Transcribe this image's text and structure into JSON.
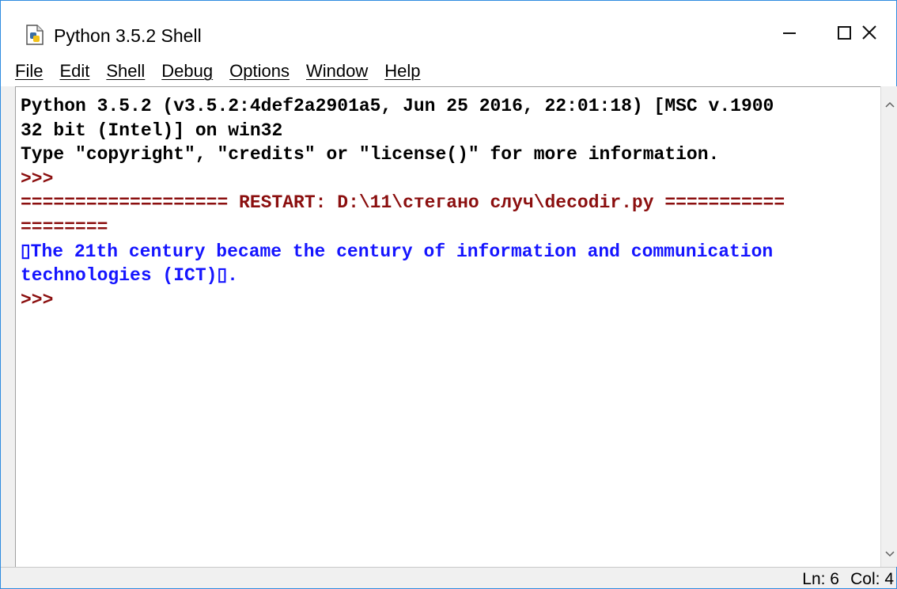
{
  "window": {
    "title": "Python 3.5.2 Shell",
    "icon": "python-file-icon"
  },
  "menubar": {
    "items": [
      "File",
      "Edit",
      "Shell",
      "Debug",
      "Options",
      "Window",
      "Help"
    ]
  },
  "shell": {
    "lines": [
      "Python 3.5.2 (v3.5.2:4def2a2901a5, Jun 25 2016, 22:01:18) [MSC v.1900",
      "32 bit (Intel)] on win32",
      "Type \"copyright\", \"credits\" or \"license()\" for more information.",
      ">>>",
      "=================== RESTART: D:\\11\\стегано случ\\decodir.py ===========",
      "========",
      "▯The 21th century became the century of information and communication",
      "technologies (ICT)▯.",
      ">>>"
    ]
  },
  "statusbar": {
    "line": "Ln: 6",
    "col": "Col: 4"
  },
  "colors": {
    "window_border": "#2f8ce0",
    "output_blue": "#1515ff",
    "prompt": "#8b0f0f"
  }
}
